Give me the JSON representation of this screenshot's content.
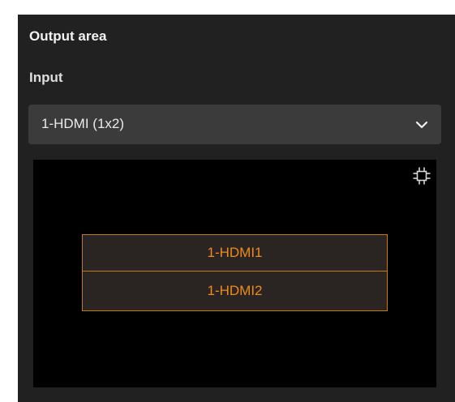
{
  "panel": {
    "title": "Output area",
    "input_label": "Input",
    "input_select": {
      "value": "1-HDMI (1x2)",
      "icon": "chevron-down-icon"
    },
    "preview": {
      "fit_icon": "fit-screen-icon",
      "cells": [
        {
          "label": "1-HDMI1"
        },
        {
          "label": "1-HDMI2"
        }
      ]
    }
  },
  "colors": {
    "panel_bg": "#212121",
    "select_bg": "#3b3b3b",
    "preview_bg": "#000000",
    "cell_bg": "#2a2522",
    "cell_border": "#c47a12",
    "cell_text": "#f08a1c"
  }
}
